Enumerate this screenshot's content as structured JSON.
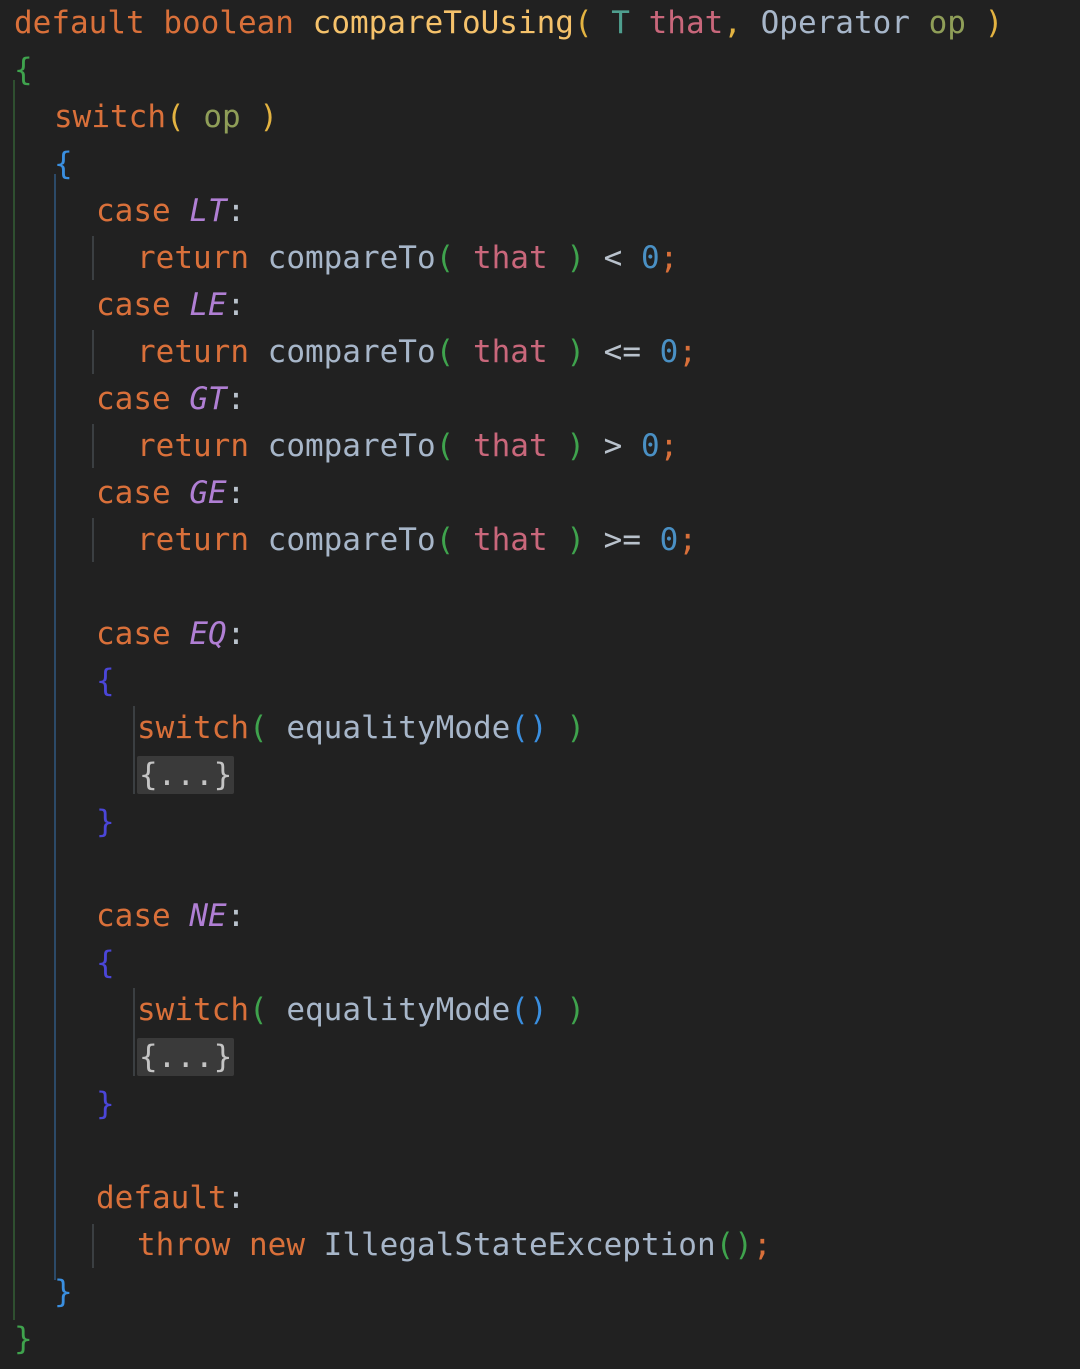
{
  "editor": {
    "language": "java",
    "theme": "dark",
    "background_color": "#212121",
    "font_size_px": 31,
    "line_height_px": 47
  },
  "colors": {
    "keyword": "#d9703a",
    "method_name": "#f5c26b",
    "type_param": "#4f9f8f",
    "parameter": "#c9677b",
    "class_or_call": "#a7b6c9",
    "variable": "#8f9e58",
    "enum_constant": "#b07fd4",
    "punctuation": "#b9c2cc",
    "number": "#4a90c4",
    "semicolon": "#d9703a",
    "bracket_gold": "#e3b341",
    "bracket_green": "#3fa34d",
    "bracket_blue": "#3a8fe0",
    "bracket_indigo": "#4b46d8",
    "fold_background": "#3a3a3a",
    "fold_text": "#c4c4c4",
    "guide_green": "#2f4f30",
    "guide_blue": "#2c4a68",
    "guide_gray": "#3b3f42"
  },
  "code": {
    "signature": {
      "modifier": "default",
      "return_type": "boolean",
      "method_name": "compareToUsing",
      "open_paren": "(",
      "param1_type": "T",
      "param1_name": "that",
      "comma": ",",
      "param2_type": "Operator",
      "param2_name": "op",
      "close_paren": ")"
    },
    "method_open_brace": "{",
    "method_close_brace": "}",
    "switch_keyword": "switch",
    "switch_open_paren": "(",
    "switch_subject": "op",
    "switch_close_paren": ")",
    "switch_open_brace": "{",
    "switch_close_brace": "}",
    "case_keyword": "case",
    "colon": ":",
    "return_keyword": "return",
    "compare_call": "compareTo",
    "that_arg": "that",
    "zero": "0",
    "semicolon": ";",
    "open_paren": "(",
    "close_paren": ")",
    "equality_mode_call": "equalityMode",
    "folded_block": "{...}",
    "default_keyword": "default",
    "throw_keyword": "throw",
    "new_keyword": "new",
    "exception_class": "IllegalStateException",
    "case_open_brace": "{",
    "case_close_brace": "}",
    "cases": [
      {
        "label": "LT",
        "operator": "<"
      },
      {
        "label": "LE",
        "operator": "<="
      },
      {
        "label": "GT",
        "operator": ">"
      },
      {
        "label": "GE",
        "operator": ">="
      },
      {
        "label": "EQ",
        "operator": ""
      },
      {
        "label": "NE",
        "operator": ""
      }
    ]
  }
}
